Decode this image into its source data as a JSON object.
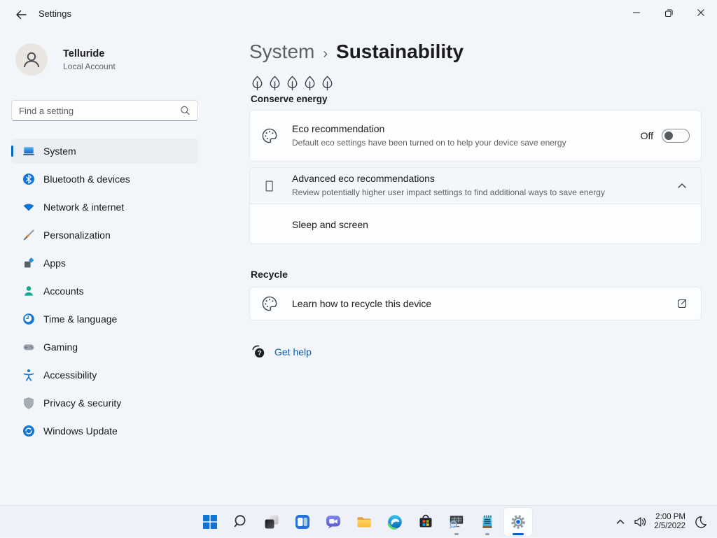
{
  "colors": {
    "accent": "#0067C0",
    "link_blue": "#0B5CAB",
    "window_bg": "#f2f5fa",
    "card_bg": "#fcfdfe"
  },
  "window": {
    "app_title": "Settings"
  },
  "profile": {
    "name": "Telluride",
    "account_type": "Local Account"
  },
  "search": {
    "placeholder": "Find a setting"
  },
  "sidebar": {
    "items": [
      {
        "label": "System",
        "icon": "system-icon",
        "active": true
      },
      {
        "label": "Bluetooth & devices",
        "icon": "bluetooth-icon",
        "active": false
      },
      {
        "label": "Network & internet",
        "icon": "network-icon",
        "active": false
      },
      {
        "label": "Personalization",
        "icon": "personalization-icon",
        "active": false
      },
      {
        "label": "Apps",
        "icon": "apps-icon",
        "active": false
      },
      {
        "label": "Accounts",
        "icon": "accounts-icon",
        "active": false
      },
      {
        "label": "Time & language",
        "icon": "time-language-icon",
        "active": false
      },
      {
        "label": "Gaming",
        "icon": "gaming-icon",
        "active": false
      },
      {
        "label": "Accessibility",
        "icon": "accessibility-icon",
        "active": false
      },
      {
        "label": "Privacy & security",
        "icon": "privacy-security-icon",
        "active": false
      },
      {
        "label": "Windows Update",
        "icon": "windows-update-icon",
        "active": false
      }
    ]
  },
  "page": {
    "breadcrumb": {
      "parent": "System",
      "separator": "›",
      "current": "Sustainability"
    },
    "conserve_energy": {
      "label": "Conserve energy",
      "leaf_count": 5
    },
    "eco_recommendation": {
      "title": "Eco recommendation",
      "description": "Default eco settings have been turned on to help your device save energy",
      "toggle_label": "Off",
      "toggle_state": "off"
    },
    "advanced_eco": {
      "title": "Advanced eco recommendations",
      "description": "Review potentially higher user impact settings to find additional ways to save energy",
      "expanded": true,
      "rows": [
        {
          "label": "Sleep and screen"
        }
      ]
    },
    "recycle": {
      "heading": "Recycle",
      "rows": [
        {
          "label": "Learn how to recycle this device"
        }
      ]
    },
    "get_help": {
      "label": "Get help"
    }
  },
  "taskbar": {
    "pinned": [
      "start",
      "search",
      "task-view",
      "widgets",
      "chat",
      "file-explorer",
      "edge",
      "microsoft-store",
      "system-monitor",
      "notepad",
      "settings"
    ],
    "running_apps": [
      "system-monitor",
      "notepad",
      "settings"
    ],
    "active_app": "settings",
    "tray": {
      "time": "2:00 PM",
      "date": "2/5/2022",
      "icons": [
        "chevron-up",
        "speaker",
        "focus-assist-moon"
      ]
    }
  },
  "icons": {
    "back": "left-arrow",
    "minimize": "horizontal-line",
    "restore": "overlapping-squares",
    "close": "x-cross",
    "search": "magnifier",
    "leaf": "outlined-leaf-with-stem",
    "eco": "palette-outline",
    "advanced_eco": "placeholder-box",
    "collapse": "chevron-up",
    "recycle_link": "external-link",
    "get_help": "question-mark-circle",
    "tray_speaker": "speaker-with-waves",
    "tray_moon": "crescent-moon"
  }
}
